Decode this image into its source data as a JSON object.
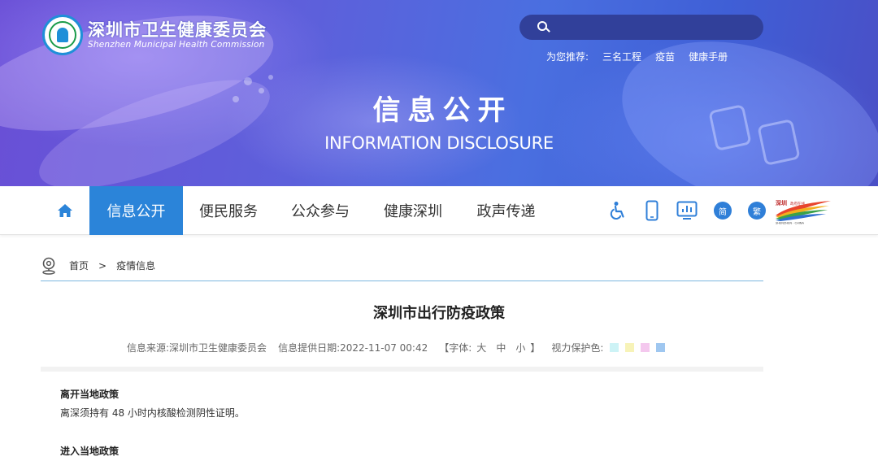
{
  "header": {
    "org_cn": "深圳市卫生健康委员会",
    "org_en": "Shenzhen Municipal Health Commission",
    "search_placeholder": "",
    "recommend_label": "为您推荐:",
    "recommend_links": [
      "三名工程",
      "疫苗",
      "健康手册"
    ],
    "title": "信息公开",
    "subtitle": "INFORMATION DISCLOSURE"
  },
  "nav": {
    "home_icon": "home-icon",
    "items": [
      {
        "label": "信息公开",
        "active": true
      },
      {
        "label": "便民服务",
        "active": false
      },
      {
        "label": "公众参与",
        "active": false
      },
      {
        "label": "健康深圳",
        "active": false
      },
      {
        "label": "政声传递",
        "active": false
      }
    ],
    "tools": {
      "accessibility_icon": "wheelchair-icon",
      "mobile_icon": "mobile-phone-icon",
      "screen_icon": "screen-reader-icon",
      "simplified": "简",
      "traditional": "繁"
    },
    "brand_icon": "shenzhen-china-logo-icon"
  },
  "breadcrumb": {
    "icon": "location-pin-icon",
    "home": "首页",
    "separator": ">",
    "current": "疫情信息"
  },
  "article": {
    "title": "深圳市出行防疫政策",
    "source_label": "信息来源:",
    "source": "深圳市卫生健康委员会",
    "date_label": "信息提供日期:",
    "date": "2022-11-07 00:42",
    "font_open": "【字体:",
    "font_large": "大",
    "font_medium": "中",
    "font_small": "小",
    "font_close": "】",
    "eye_care_label": "视力保护色:",
    "eye_care_colors": [
      "#cdf3f6",
      "#f7f3b8",
      "#f4c8ee",
      "#9fc7f0"
    ],
    "sections": [
      {
        "heading": "离开当地政策",
        "text": "离深须持有 48 小时内核酸检测阴性证明。"
      },
      {
        "heading": "进入当地政策",
        "text": ""
      }
    ]
  },
  "colors": {
    "nav_active": "#2b84d9",
    "search_bg": "#31409a",
    "divider": "#7cb7df"
  }
}
